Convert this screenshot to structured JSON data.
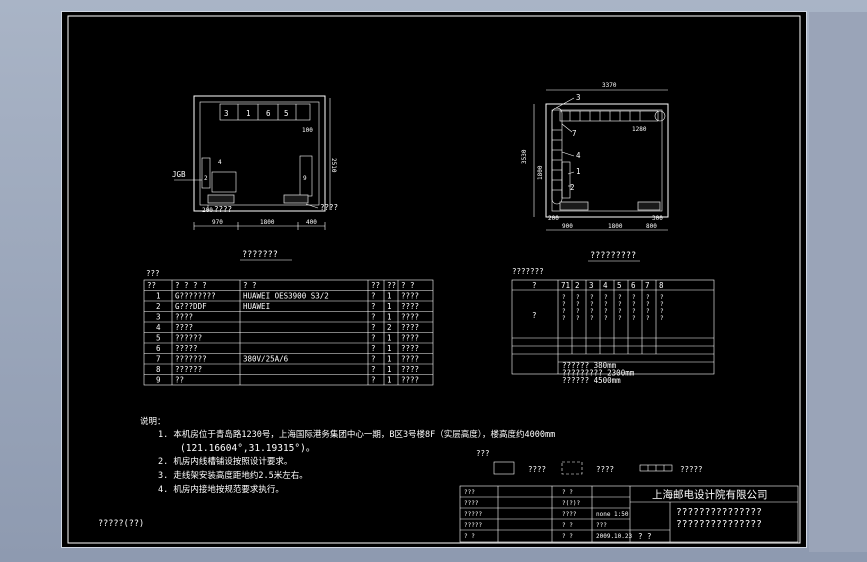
{
  "left_plan": {
    "title": "???????",
    "labels": {
      "jgb": "JGB",
      "bars": [
        "3",
        "1",
        "6",
        "5"
      ],
      "side_2": "2",
      "side_9": "9",
      "small_4": "4",
      "top_right_100": "100",
      "door_note": "????",
      "left_note": "????",
      "dim_right": "2510",
      "dim_bottom": [
        "970",
        "1800",
        "400"
      ],
      "dim_bottom_left": "200"
    }
  },
  "right_plan": {
    "title": "?????????",
    "labels": {
      "callouts": [
        "3",
        "7",
        "4",
        "1",
        "2"
      ],
      "dim_top": "3370",
      "dim_inner": "1280",
      "dim_left_outer": "3530",
      "dim_left_inner": "1800",
      "dim_bottom": [
        "900",
        "1800",
        "800"
      ],
      "dim_bottom_left": "200",
      "dim_bottom_right": "300"
    }
  },
  "equipment_table": {
    "caption": "???",
    "headers": [
      "??",
      "? ? ? ?",
      "? ?",
      "??",
      "??",
      "? ?"
    ],
    "rows": [
      [
        "1",
        "G????????",
        "HUAWEI OES3900 S3/2",
        "?",
        "1",
        "????"
      ],
      [
        "2",
        "G???DDF",
        "HUAWEI",
        "?",
        "1",
        "????"
      ],
      [
        "3",
        "????",
        "",
        "?",
        "1",
        "????"
      ],
      [
        "4",
        "????",
        "",
        "?",
        "2",
        "????"
      ],
      [
        "5",
        "??????",
        "",
        "?",
        "1",
        "????"
      ],
      [
        "6",
        "?????",
        "",
        "?",
        "1",
        "????"
      ],
      [
        "7",
        "???????",
        "380V/25A/6",
        "?",
        "1",
        "????"
      ],
      [
        "8",
        "??????",
        "",
        "?",
        "1",
        "????"
      ],
      [
        "9",
        "??",
        "",
        "?",
        "1",
        "????"
      ]
    ]
  },
  "cable_table": {
    "caption": "???????",
    "headers": [
      "?",
      "71",
      "2",
      "3",
      "4",
      "5",
      "6",
      "7",
      "8"
    ],
    "row_label": "?",
    "row_values": [
      "??",
      "??",
      "??",
      "??",
      "??",
      "??",
      "??",
      "??"
    ],
    "notes": [
      "?????? 380mm",
      "????????? 2300mm",
      "?????? 4500mm"
    ]
  },
  "notes": {
    "heading": "说明：",
    "items": [
      "1.   本机房位于青岛路1230号，上海国际港务集团中心一期，B区3号楼8F（实层高度），楼高度约4000mm",
      "(121.16604°,31.19315°)。",
      "2.   机房内线槽铺设按照设计要求。",
      "3.   走线架安装高度距地约2.5米左右。",
      "4.   机房内接地按规范要求执行。"
    ]
  },
  "legend": {
    "title": "???",
    "items": [
      "????",
      "????",
      "?????"
    ]
  },
  "title_block": {
    "company": "上海邮电设计院有限公司",
    "drawing_title_1": "???????????????",
    "drawing_title_2": "???????????????",
    "rows": [
      [
        "???",
        "",
        "? ?",
        ""
      ],
      [
        "????",
        "",
        "?(?)?",
        ""
      ],
      [
        "?????",
        "",
        "????",
        "none 1:50"
      ],
      [
        "?????",
        "",
        "? ?",
        "???"
      ],
      [
        "? ?",
        "",
        "? ?",
        "2009.10.23"
      ]
    ],
    "extra_cell": "? ?"
  },
  "stamp": "?????(??)",
  "colors": {
    "viewport_bg": "#000000",
    "line": "#ffffff",
    "outer_bg": "#9aa4b8"
  }
}
